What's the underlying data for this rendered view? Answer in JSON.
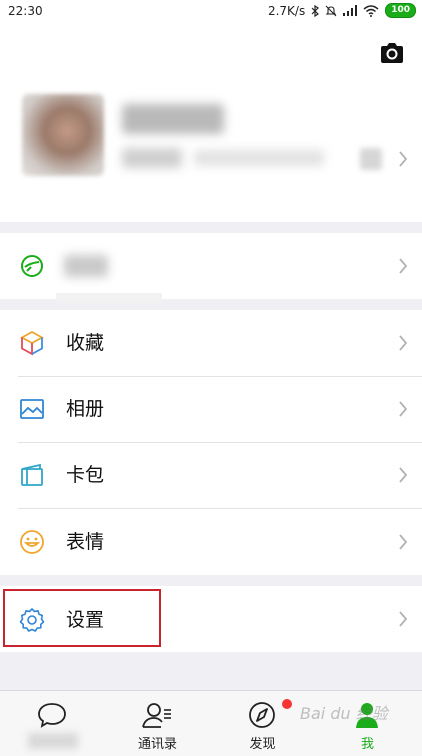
{
  "status_bar": {
    "time": "22:30",
    "net_speed": "2.7K/s",
    "battery": "100",
    "icons": [
      "bluetooth-icon",
      "silent-icon",
      "signal-icon",
      "wifi-icon",
      "battery-icon"
    ]
  },
  "profile": {
    "camera_icon": "camera-icon"
  },
  "menu": {
    "favorites": "收藏",
    "album": "相册",
    "cards": "卡包",
    "stickers": "表情",
    "settings": "设置"
  },
  "tabbar": {
    "chats": "",
    "contacts": "通讯录",
    "discover": "发现",
    "me": "我"
  },
  "watermark": "Bai du 经验",
  "colors": {
    "accent": "#1aad19",
    "badge": "#f43530",
    "highlight": "#c9232d"
  }
}
